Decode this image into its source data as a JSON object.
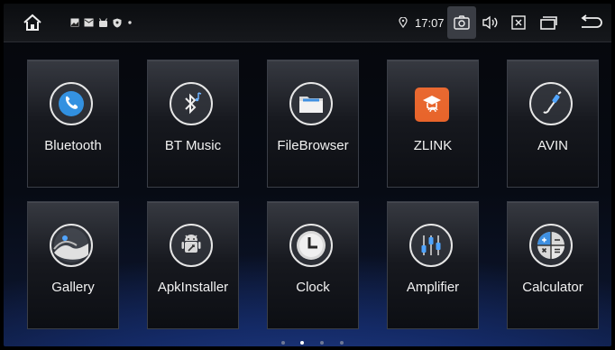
{
  "status_bar": {
    "time": "17:07",
    "icons": {
      "home": "home-icon",
      "notifications": [
        "image-icon",
        "mail-icon",
        "android-icon",
        "shield-icon",
        "dot-icon"
      ],
      "location": "location-icon",
      "screenshot": "camera-icon",
      "volume": "volume-icon",
      "close": "close-box-icon",
      "recents": "window-icon",
      "back": "back-arrow-icon"
    }
  },
  "apps": [
    {
      "label": "Bluetooth",
      "icon": "phone-icon"
    },
    {
      "label": "BT Music",
      "icon": "bluetooth-music-icon"
    },
    {
      "label": "FileBrowser",
      "icon": "folder-icon"
    },
    {
      "label": "ZLINK",
      "icon": "zlink-icon"
    },
    {
      "label": "AVIN",
      "icon": "av-cable-icon"
    },
    {
      "label": "Gallery",
      "icon": "gallery-icon"
    },
    {
      "label": "ApkInstaller",
      "icon": "android-installer-icon"
    },
    {
      "label": "Clock",
      "icon": "clock-icon"
    },
    {
      "label": "Amplifier",
      "icon": "equalizer-icon"
    },
    {
      "label": "Calculator",
      "icon": "calculator-icon"
    }
  ],
  "pager": {
    "pages": 4,
    "current": 2
  },
  "colors": {
    "accent_blue": "#1e3f96",
    "zlink_orange": "#e8642a",
    "phone_blue": "#2f8fe0"
  }
}
